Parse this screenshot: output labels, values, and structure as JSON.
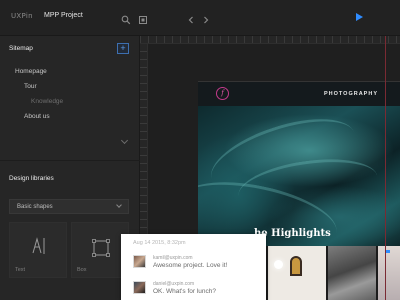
{
  "topbar": {
    "logo": "UXPin",
    "project_title": "MPP Project",
    "icons": [
      "search-icon",
      "layers-icon",
      "chevron-left-icon",
      "chevron-right-icon",
      "play-icon"
    ],
    "accent": "#2f8cff"
  },
  "sidebar": {
    "sitemap_heading": "Sitemap",
    "add_label": "+",
    "pages": [
      {
        "label": "Homepage",
        "level": 0
      },
      {
        "label": "Tour",
        "level": 1
      },
      {
        "label": "Knowledge",
        "level": 2
      },
      {
        "label": "About us",
        "level": 1
      }
    ],
    "design_libraries_heading": "Design libraries",
    "library_select": "Basic shapes",
    "library_items": [
      {
        "label": "Text",
        "icon": "text-tool-icon"
      },
      {
        "label": "Box",
        "icon": "box-tool-icon"
      }
    ]
  },
  "artboard": {
    "nav_title": "PHOTOGRAPHY",
    "brand_glyph": "f",
    "headline": "he Highlights",
    "brand_color": "#c23a8a"
  },
  "comments": {
    "date": "Aug 14 2015, 8:32pm",
    "items": [
      {
        "email": "kamil@uxpin.com",
        "text": "Awesome project. Love it!"
      },
      {
        "email": "daniel@uxpin.com",
        "text": "OK. What's for lunch?"
      }
    ]
  }
}
